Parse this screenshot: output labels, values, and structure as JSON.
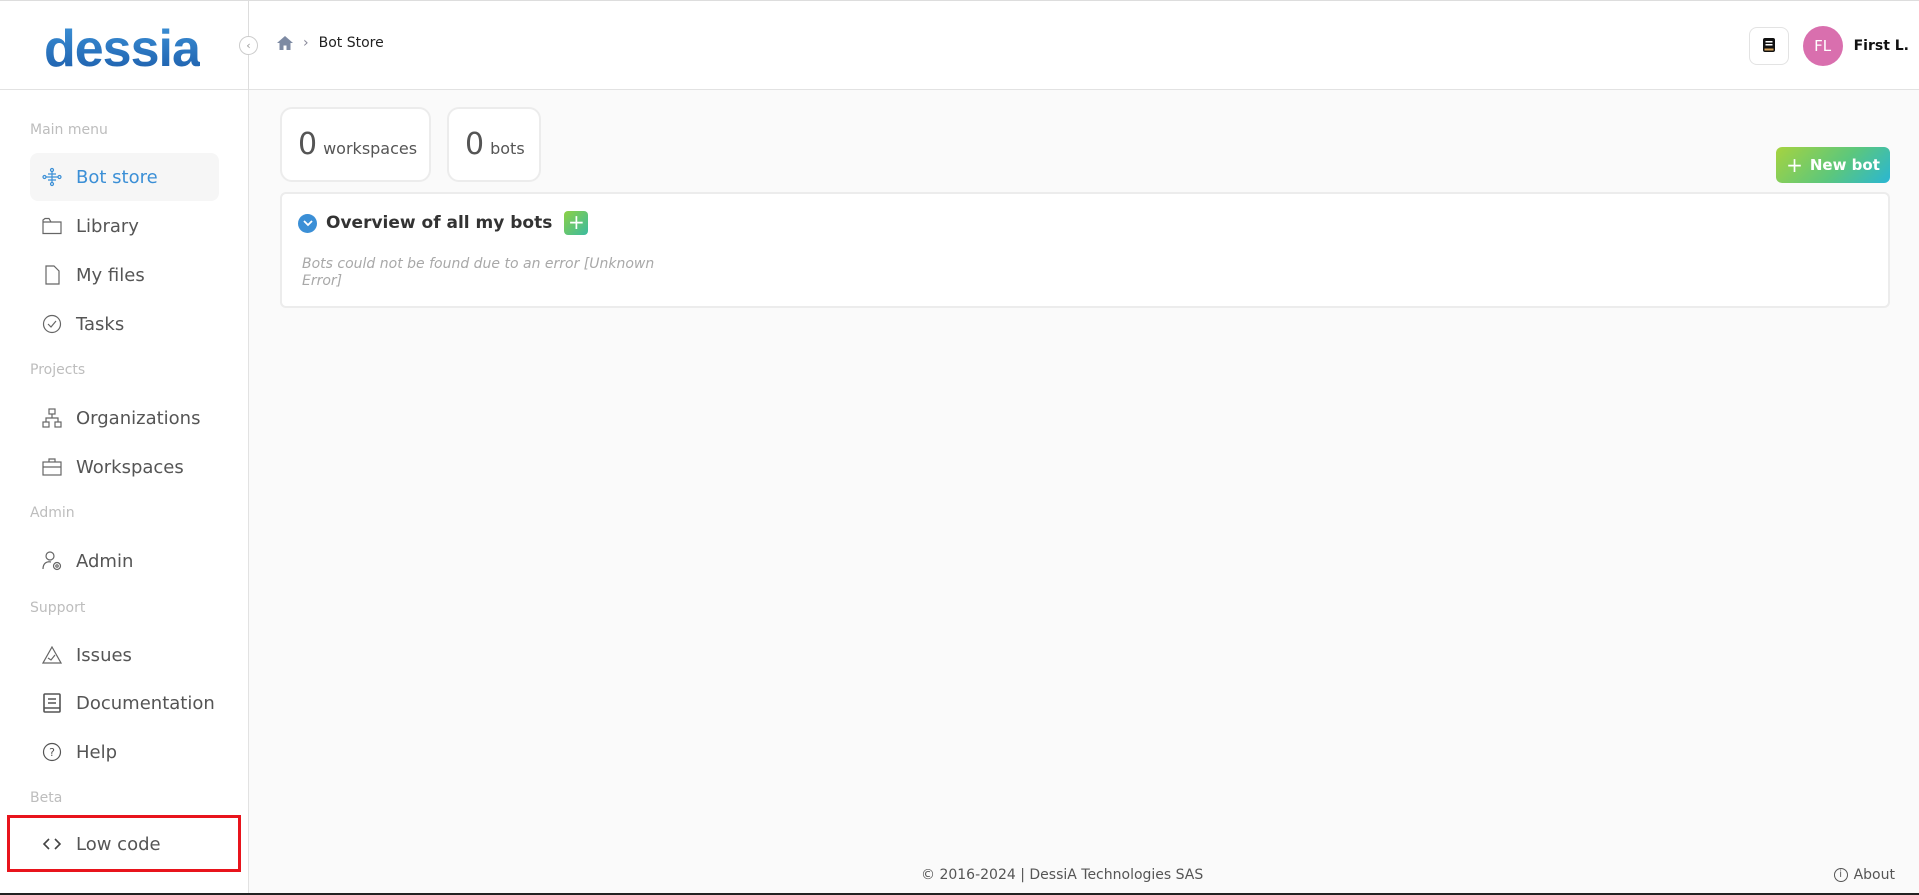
{
  "header": {
    "logo": "dessia",
    "collapse_icon": "chevron-left-icon",
    "breadcrumb": {
      "home_icon": "home-icon",
      "current": "Bot Store"
    },
    "doc_button_icon": "book-icon",
    "user": {
      "initials": "FL",
      "name": "First L.",
      "avatar_color": "#d96fae"
    }
  },
  "sidebar": {
    "sections": [
      {
        "label": "Main menu"
      },
      {
        "label": "Projects"
      },
      {
        "label": "Admin"
      },
      {
        "label": "Support"
      },
      {
        "label": "Beta"
      }
    ],
    "items": [
      {
        "label": "Bot store",
        "icon": "bot-network-icon",
        "active": true
      },
      {
        "label": "Library",
        "icon": "folder-icon"
      },
      {
        "label": "My files",
        "icon": "file-icon"
      },
      {
        "label": "Tasks",
        "icon": "check-circle-icon"
      },
      {
        "label": "Organizations",
        "icon": "org-chart-icon"
      },
      {
        "label": "Workspaces",
        "icon": "briefcase-icon"
      },
      {
        "label": "Admin",
        "icon": "user-gear-icon"
      },
      {
        "label": "Issues",
        "icon": "warning-icon"
      },
      {
        "label": "Documentation",
        "icon": "book-icon"
      },
      {
        "label": "Help",
        "icon": "help-circle-icon"
      },
      {
        "label": "Low code",
        "icon": "code-icon"
      }
    ],
    "accent": "#3b8fd6"
  },
  "main": {
    "stats": [
      {
        "value": "0",
        "label": "workspaces"
      },
      {
        "value": "0",
        "label": "bots"
      }
    ],
    "new_bot_label": "New bot",
    "panel": {
      "title": "Overview of all my bots",
      "add_label": "+",
      "error": "Bots could not be found due to an error [Unknown Error]"
    }
  },
  "footer": {
    "copyright": "© 2016-2024 | DessiA Technologies SAS",
    "about": "About"
  }
}
